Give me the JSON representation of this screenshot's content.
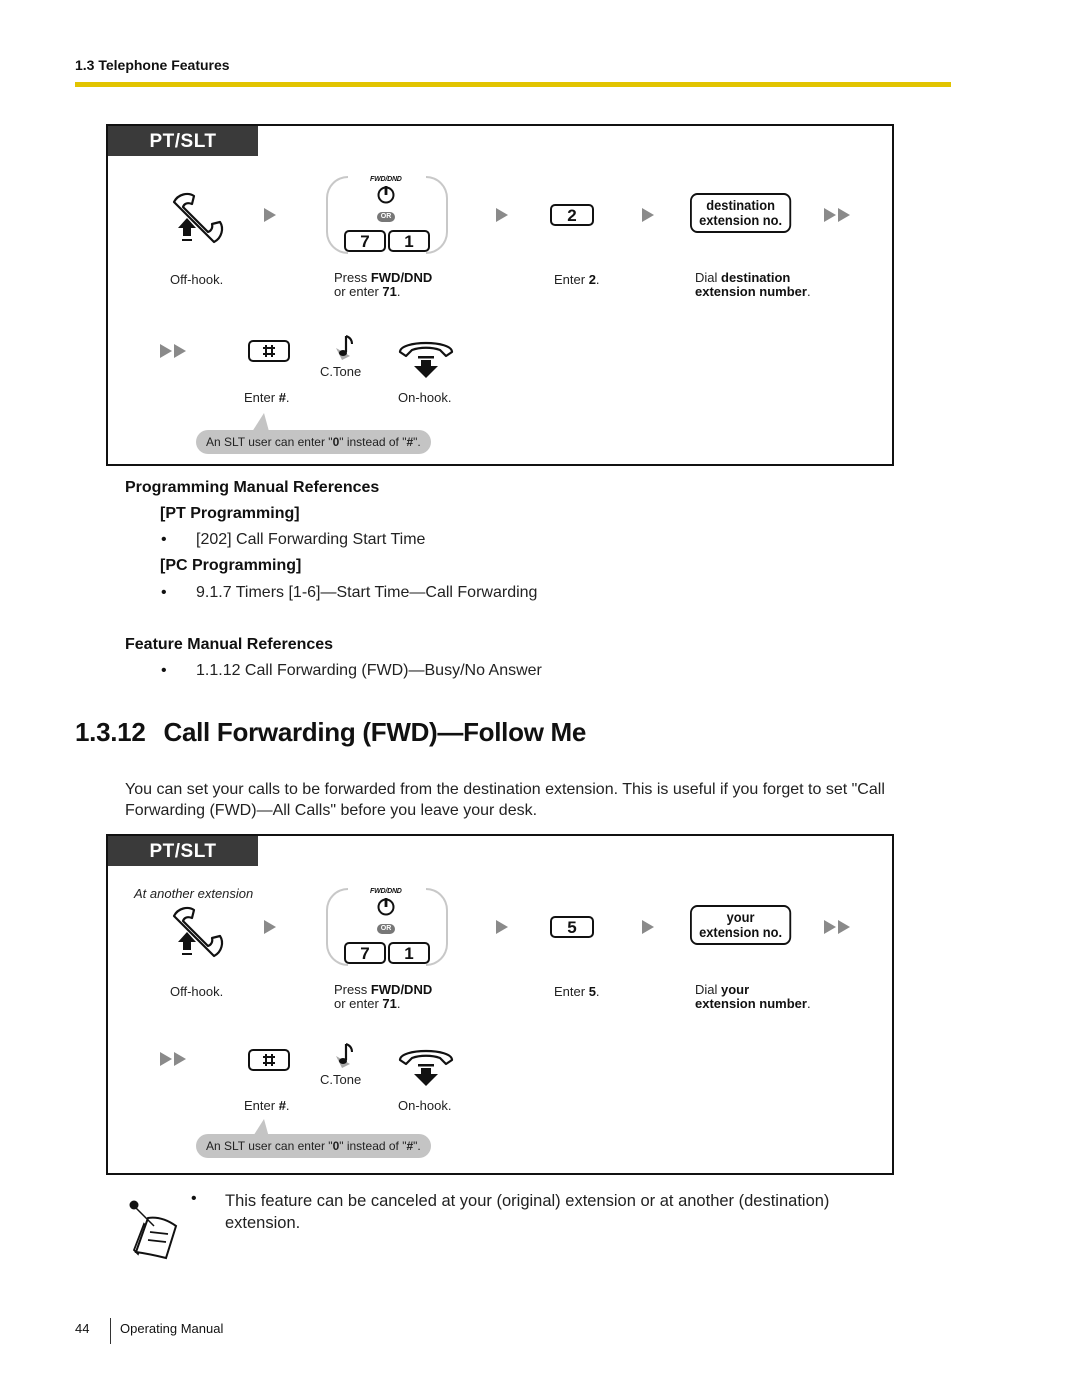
{
  "header": {
    "section": "1.3 Telephone Features",
    "rule_color": "#e2c400"
  },
  "procedure_1": {
    "tab_label": "PT/SLT",
    "fwd_dnd_label": "FWD/DND",
    "or_label": "OR",
    "key_7": "7",
    "key_1": "1",
    "key_digit": "2",
    "ext_box_line1": "destination",
    "ext_box_line2": "extension no.",
    "captions": {
      "off_hook": "Off-hook.",
      "press_prefix": "Press ",
      "press_bold": "FWD/DND",
      "press_line2_prefix": "or enter ",
      "press_line2_bold": "71",
      "press_line2_suffix": ".",
      "enter_prefix": "Enter ",
      "enter_bold": "2",
      "enter_suffix": ".",
      "dial_prefix": "Dial ",
      "dial_bold1": "destination",
      "dial_bold2": "extension number",
      "dial_suffix": ".",
      "ctone": "C.Tone",
      "enter_hash_prefix": "Enter ",
      "enter_hash_bold": "#",
      "enter_hash_suffix": ".",
      "on_hook": "On-hook."
    },
    "hint": {
      "prefix": "An SLT user can enter \"",
      "bold1": "0",
      "middle": "\" instead of \"",
      "bold2": "#",
      "suffix": "\"."
    }
  },
  "references": {
    "programming_heading": "Programming Manual References",
    "pt_heading": "[PT Programming]",
    "pt_items": [
      "[202] Call Forwarding Start Time"
    ],
    "pc_heading": "[PC Programming]",
    "pc_items": [
      "9.1.7 Timers [1-6]—Start Time—Call Forwarding"
    ],
    "feature_heading": "Feature Manual References",
    "feature_items": [
      "1.1.12 Call Forwarding (FWD)—Busy/No Answer"
    ],
    "bullet": "•"
  },
  "section": {
    "number": "1.3.12",
    "title": "Call Forwarding (FWD)—Follow Me",
    "intro": "You can set your calls to be forwarded from the destination extension. This is useful if you forget to set \"Call Forwarding (FWD)—All Calls\" before you leave your desk."
  },
  "procedure_2": {
    "tab_label": "PT/SLT",
    "location_note": "At another extension",
    "fwd_dnd_label": "FWD/DND",
    "or_label": "OR",
    "key_7": "7",
    "key_1": "1",
    "key_digit": "5",
    "ext_box_line1": "your",
    "ext_box_line2": "extension no.",
    "captions": {
      "off_hook": "Off-hook.",
      "press_prefix": "Press ",
      "press_bold": "FWD/DND",
      "press_line2_prefix": "or enter ",
      "press_line2_bold": "71",
      "press_line2_suffix": ".",
      "enter_prefix": "Enter ",
      "enter_bold": "5",
      "enter_suffix": ".",
      "dial_prefix": "Dial ",
      "dial_bold1": "your",
      "dial_bold2": "extension number",
      "dial_suffix": ".",
      "ctone": "C.Tone",
      "enter_hash_prefix": "Enter ",
      "enter_hash_bold": "#",
      "enter_hash_suffix": ".",
      "on_hook": "On-hook."
    },
    "hint": {
      "prefix": "An SLT user can enter \"",
      "bold1": "0",
      "middle": "\" instead of \"",
      "bold2": "#",
      "suffix": "\"."
    }
  },
  "note": {
    "bullet": "•",
    "text": "This feature can be canceled at your (original) extension or at another (destination) extension."
  },
  "footer": {
    "page_number": "44",
    "label": "Operating Manual"
  }
}
